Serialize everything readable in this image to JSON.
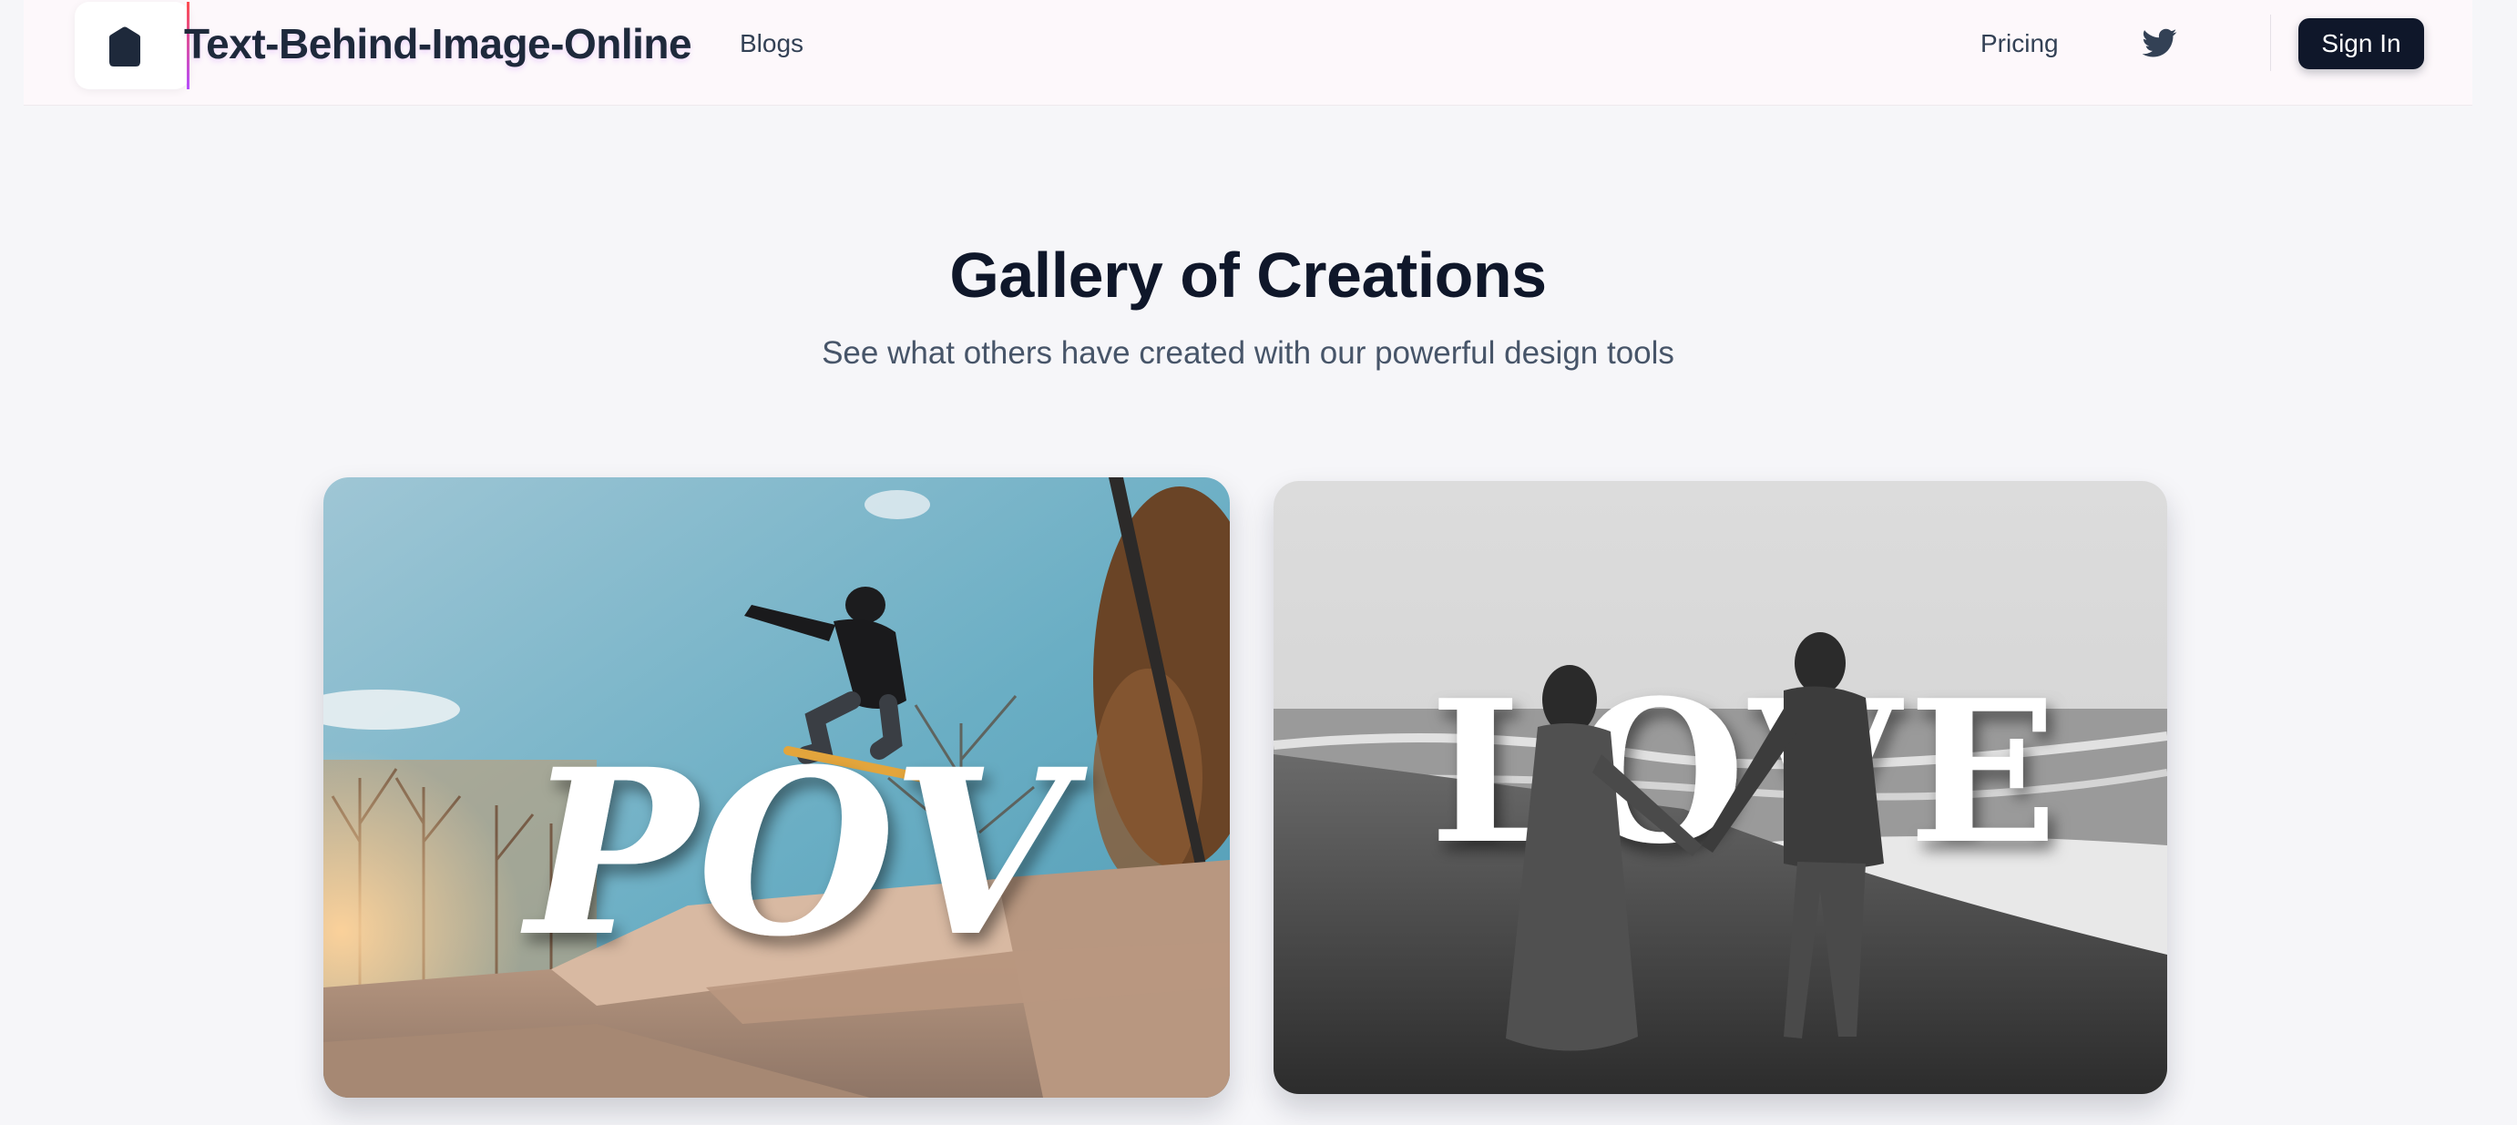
{
  "header": {
    "brand": "Text-Behind-Image-Online",
    "nav": {
      "blogs": "Blogs",
      "pricing": "Pricing"
    },
    "sign_in": "Sign In",
    "icons": {
      "logo": "hexagon-logo-icon",
      "social": "twitter-icon"
    }
  },
  "gallery": {
    "title": "Gallery of Creations",
    "subtitle": "See what others have created with our powerful design tools",
    "items": [
      {
        "overlay_text": "POV",
        "scene": "skateboarder jumping at skatepark"
      },
      {
        "overlay_text": "LOVE",
        "scene": "couple holding hands on beach"
      }
    ]
  },
  "colors": {
    "page_bg": "#f6f6f9",
    "header_bg": "#fdf8fb",
    "primary_button": "#0f172a",
    "text_primary": "#0f172a",
    "text_muted": "#475569"
  }
}
